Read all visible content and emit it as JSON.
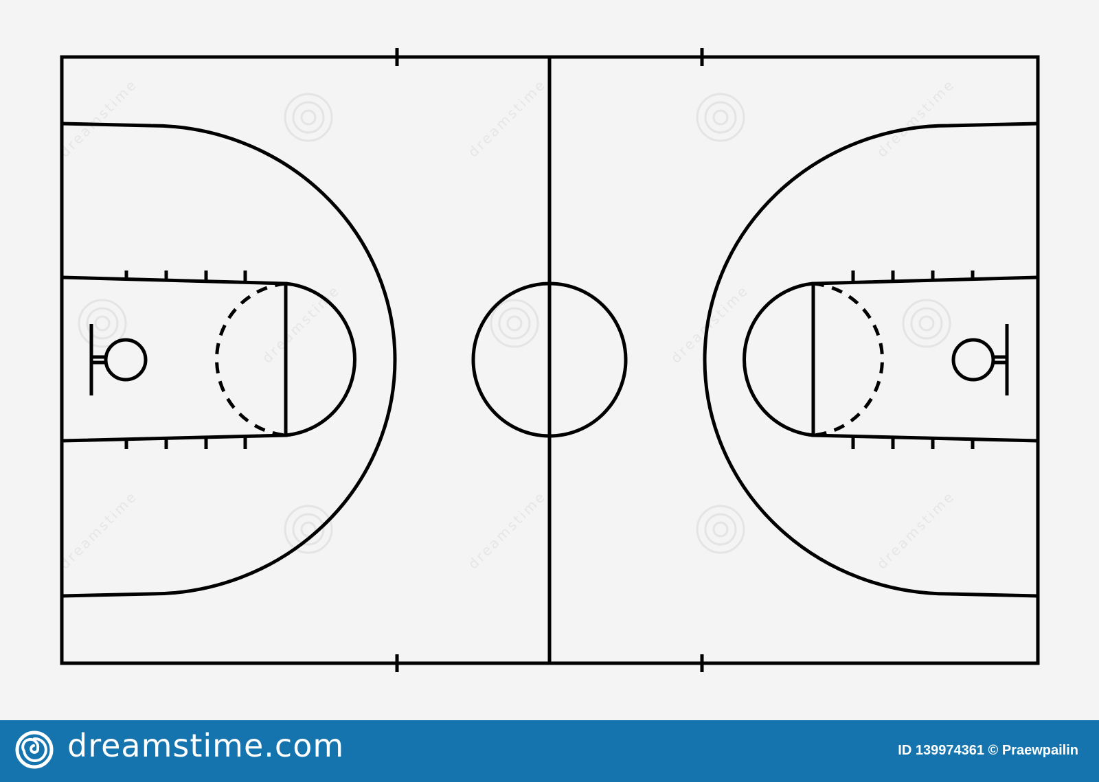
{
  "watermark": {
    "brand": "dreamstime"
  },
  "footer": {
    "logo_text": "dreamstime.com",
    "image_id": "ID 139974361",
    "copyright_symbol": "©",
    "author": "Praewpailin",
    "background_color": "#1574ae",
    "text_color": "#ffffff"
  },
  "court": {
    "line_color": "#000000",
    "background_color": "#f4f4f4"
  }
}
